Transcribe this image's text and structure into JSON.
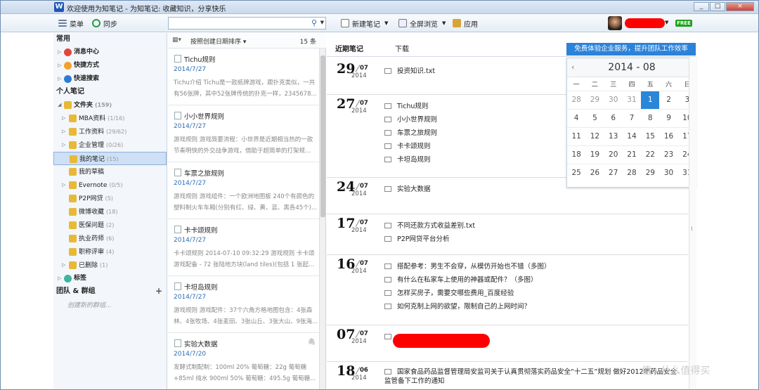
{
  "window": {
    "title": "欢迎使用为知笔记 - 为知笔记: 收藏知识，分享快乐",
    "logo": "W",
    "controls": [
      "_",
      "□",
      "×"
    ]
  },
  "toolbar": {
    "menu": "菜单",
    "sync": "同步",
    "new_note": "新建笔记",
    "fullscreen": "全屏浏览",
    "apps": "应用",
    "free_badge": "FREE"
  },
  "left": {
    "common_header": "常用",
    "common": [
      {
        "label": "消息中心",
        "icon": "message-icon"
      },
      {
        "label": "快捷方式",
        "icon": "shortcut-icon"
      },
      {
        "label": "快速搜索",
        "icon": "quick-search-icon"
      }
    ],
    "personal_header": "个人笔记",
    "folders_root": {
      "label": "文件夹",
      "count": "(159)"
    },
    "folders": [
      {
        "label": "MBA资料",
        "count": "(1/16)",
        "arrow": true,
        "selected": false
      },
      {
        "label": "工作资料",
        "count": "(29/62)",
        "arrow": true,
        "selected": false
      },
      {
        "label": "企业管理",
        "count": "(0/26)",
        "arrow": true,
        "selected": false
      },
      {
        "label": "我的笔记",
        "count": "(15)",
        "arrow": false,
        "selected": true
      },
      {
        "label": "我的草稿",
        "count": "",
        "arrow": false,
        "selected": false
      },
      {
        "label": "Evernote",
        "count": "(0/5)",
        "arrow": true,
        "selected": false
      },
      {
        "label": "P2P网贷",
        "count": "(5)",
        "arrow": false,
        "selected": false
      },
      {
        "label": "微博收藏",
        "count": "(18)",
        "arrow": false,
        "selected": false
      },
      {
        "label": "医保问题",
        "count": "(2)",
        "arrow": false,
        "selected": false
      },
      {
        "label": "执业药师",
        "count": "(6)",
        "arrow": false,
        "selected": false
      },
      {
        "label": "职称评审",
        "count": "(4)",
        "arrow": false,
        "selected": false
      },
      {
        "label": "已删除",
        "count": "(1)",
        "arrow": true,
        "selected": false
      }
    ],
    "tags": "标签",
    "team_header": "团队 & 群组",
    "new_group": "创建新的群组..."
  },
  "middle": {
    "search_placeholder": "",
    "sort_label": "按照创建日期排序",
    "count": "15 条",
    "notes": [
      {
        "title": "Tichu规则",
        "date": "2014/7/27",
        "snippet": "Tichu介绍 Tichu是一款纸牌游戏，跟扑克类似，一共有56张牌，其中52张牌传统的扑克一样，2345678..."
      },
      {
        "title": "小小世界规则",
        "date": "2014/7/27",
        "snippet": "游戏规则 游戏简要流程：小世界是近期相当热的一款节奏明快的外交战争游戏，借助于超简单的打架规..."
      },
      {
        "title": "车票之旅规则",
        "date": "2014/7/27",
        "snippet": "游戏规则 游戏组件：一个欧洲地图板 240个有颜色的塑料制火车车厢(分别有红、绿、黄、蓝、黑各45个)..."
      },
      {
        "title": "卡卡颂规则",
        "date": "2014/7/27",
        "snippet": "卡卡颂规则 2014-07-10 09:32:29 游戏规则 卡卡颂 游戏配备 - 72 张陆地方块(land tiles)(包括 1 张起..."
      },
      {
        "title": "卡坦岛规则",
        "date": "2014/7/27",
        "snippet": "游戏规则 游戏配件：37个六角方格地图包含：4张森林、4张牧场、4张麦田、3张山丘、3张大山、9张海..."
      },
      {
        "title": "实验大数据",
        "date": "2014/7/20",
        "snippet": "发酵式制配制：100ml 20% 葡萄糖：22g 葡萄糖+85ml 纯水 900ml 50% 葡萄糖：495.5g 葡萄糖..."
      }
    ]
  },
  "right": {
    "tab_recent": "近期笔记",
    "tab_download": "下载",
    "banner": "免费体验企业服务，提升团队工作效率",
    "groups": [
      {
        "day": "29",
        "month": "07",
        "year": "2014",
        "items": [
          "投资知识.txt"
        ]
      },
      {
        "day": "27",
        "month": "07",
        "year": "2014",
        "items": [
          "Tichu规则",
          "小小世界规则",
          "车票之旅规则",
          "卡卡颂规则",
          "卡坦岛规则"
        ]
      },
      {
        "day": "24",
        "month": "07",
        "year": "2014",
        "items": [
          "实验大数据"
        ]
      },
      {
        "day": "17",
        "month": "07",
        "year": "2014",
        "items": [
          "不同还款方式收益差别.txt",
          "P2P网贷平台分析"
        ]
      },
      {
        "day": "16",
        "month": "07",
        "year": "2014",
        "items": [
          "搭配参考：男生不会穿，从模仿开始也不错（多图）",
          "有什么在私家车上使用的神器或配件？（多图）",
          "怎样买房子，需要交哪些费用_百度经验",
          "如何克制上网的欲望，限制自己的上网时间？"
        ]
      },
      {
        "day": "07",
        "month": "07",
        "year": "2014",
        "items": [
          ""
        ]
      },
      {
        "day": "18",
        "month": "06",
        "year": "2014",
        "items": [
          "国家食品药品监督管理局安监司关于认真贯彻落实药品安全“十二五”规划 做好2012年药品安全监管备下工作的通知"
        ]
      }
    ]
  },
  "calendar": {
    "title": "2014 - 08",
    "prev": "‹",
    "next": "›",
    "weekdays": [
      "一",
      "二",
      "三",
      "四",
      "五",
      "六",
      "日"
    ],
    "weeks": [
      [
        "28",
        "29",
        "30",
        "31",
        "1",
        "2",
        "3"
      ],
      [
        "4",
        "5",
        "6",
        "7",
        "8",
        "9",
        "10"
      ],
      [
        "11",
        "12",
        "13",
        "14",
        "15",
        "16",
        "17"
      ],
      [
        "18",
        "19",
        "20",
        "21",
        "22",
        "23",
        "24"
      ],
      [
        "25",
        "26",
        "27",
        "28",
        "29",
        "30",
        "31"
      ]
    ],
    "muted_first_row_count": 4,
    "today": "1",
    "accent": "#2a86d8"
  },
  "watermark": "值 · 什么值得买",
  "colors": {
    "link_blue": "#2e6db4",
    "selection": "#cfe0f4",
    "redaction": "#ff0000"
  }
}
